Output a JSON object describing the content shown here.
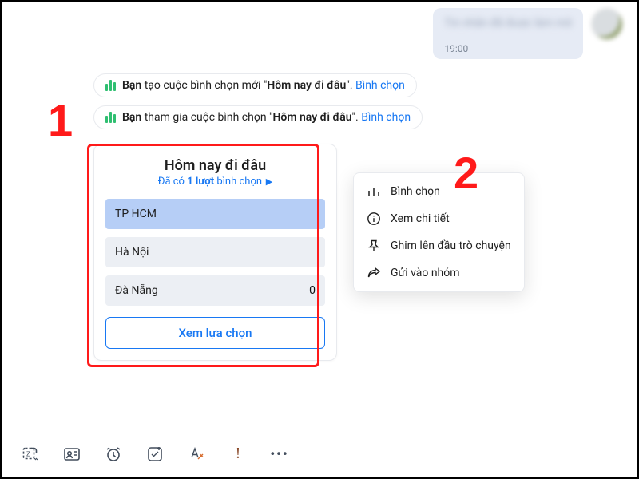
{
  "received_message": {
    "body_placeholder": "Tin nhắn đã được làm mờ",
    "time": "19:00"
  },
  "system_lines": [
    {
      "you": "Bạn",
      "verb": " tạo cuộc bình chọn mới ",
      "quote_open": "\"",
      "title": "Hôm nay đi đâu",
      "quote_close": "\". ",
      "action": "Bình chọn"
    },
    {
      "you": "Bạn",
      "verb": " tham gia cuộc bình chọn ",
      "quote_open": "\"",
      "title": "Hôm nay đi đâu",
      "quote_close": "\". ",
      "action": "Bình chọn"
    }
  ],
  "poll": {
    "title": "Hôm nay đi đâu",
    "sub_prefix": "Đã có ",
    "sub_count": "1 lượt",
    "sub_suffix": " bình chọn",
    "options": [
      {
        "label": "TP HCM",
        "count": "",
        "selected": true
      },
      {
        "label": "Hà Nội",
        "count": "",
        "selected": false
      },
      {
        "label": "Đà Nẵng",
        "count": "0",
        "selected": false
      }
    ],
    "cta": "Xem lựa chọn"
  },
  "menu": [
    {
      "name": "menu-vote",
      "icon": "bars",
      "label": "Bình chọn"
    },
    {
      "name": "menu-detail",
      "icon": "info",
      "label": "Xem chi tiết"
    },
    {
      "name": "menu-pin",
      "icon": "pin",
      "label": "Ghim lên đầu trò chuyện"
    },
    {
      "name": "menu-forward",
      "icon": "share",
      "label": "Gửi vào nhóm"
    }
  ],
  "annotations": {
    "one": "1",
    "two": "2"
  },
  "toolbar_names": [
    "sticker",
    "contact-card",
    "reminder",
    "task",
    "format",
    "priority",
    "more"
  ]
}
